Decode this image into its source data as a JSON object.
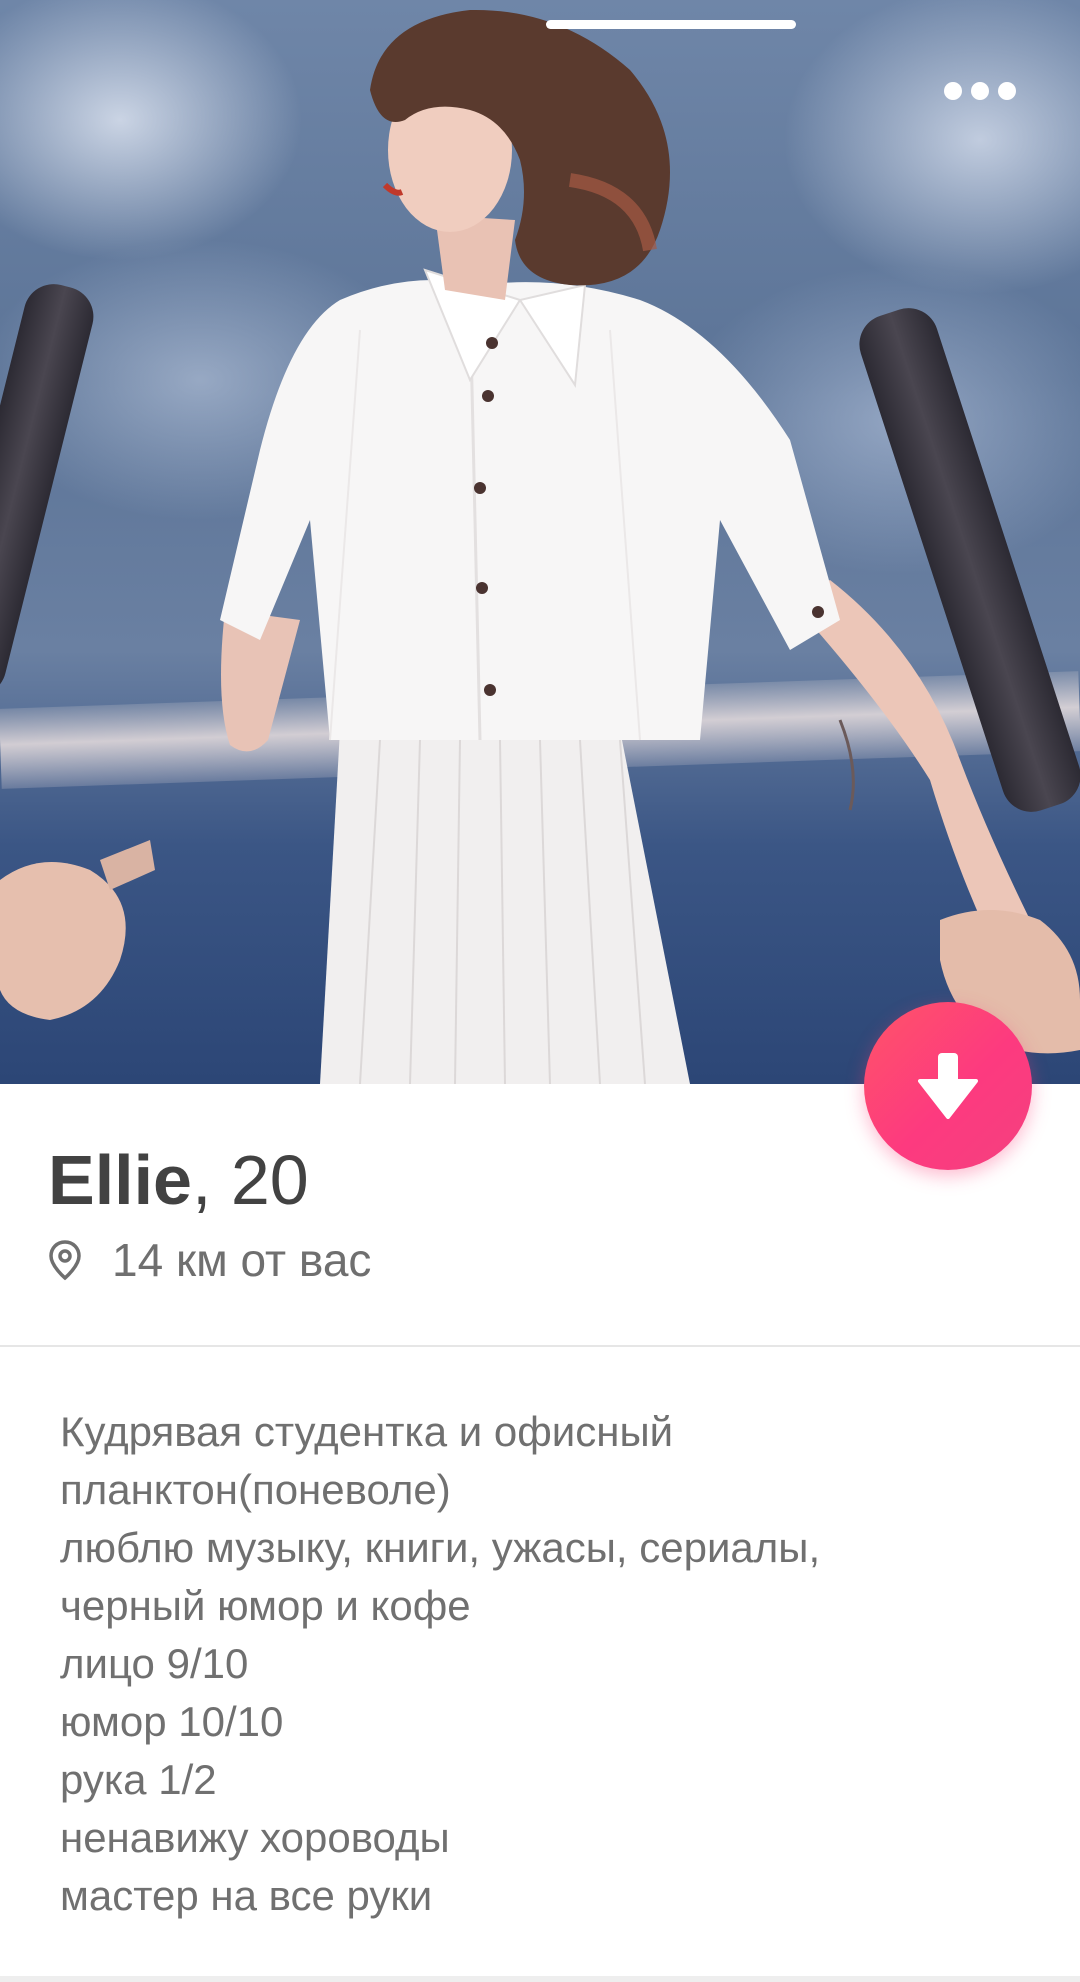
{
  "profile": {
    "name": "Ellie",
    "age_text": ", 20",
    "distance": "14 км от вас",
    "bio_lines": [
      "Кудрявая студентка и офисный",
      "планктон(поневоле)",
      "люблю музыку, книги, ужасы, сериалы,",
      "черный юмор и кофе",
      "лицо 9/10",
      "юмор 10/10",
      "рука 1/2",
      "ненавижу хороводы",
      "мастер на все руки"
    ]
  },
  "icons": {
    "more": "more-horizontal-icon",
    "collapse": "arrow-down-icon",
    "location": "location-pin-icon"
  },
  "colors": {
    "accent_start": "#fe5468",
    "accent_end": "#f4407f",
    "name_text": "#424242",
    "secondary_text": "#707070"
  }
}
